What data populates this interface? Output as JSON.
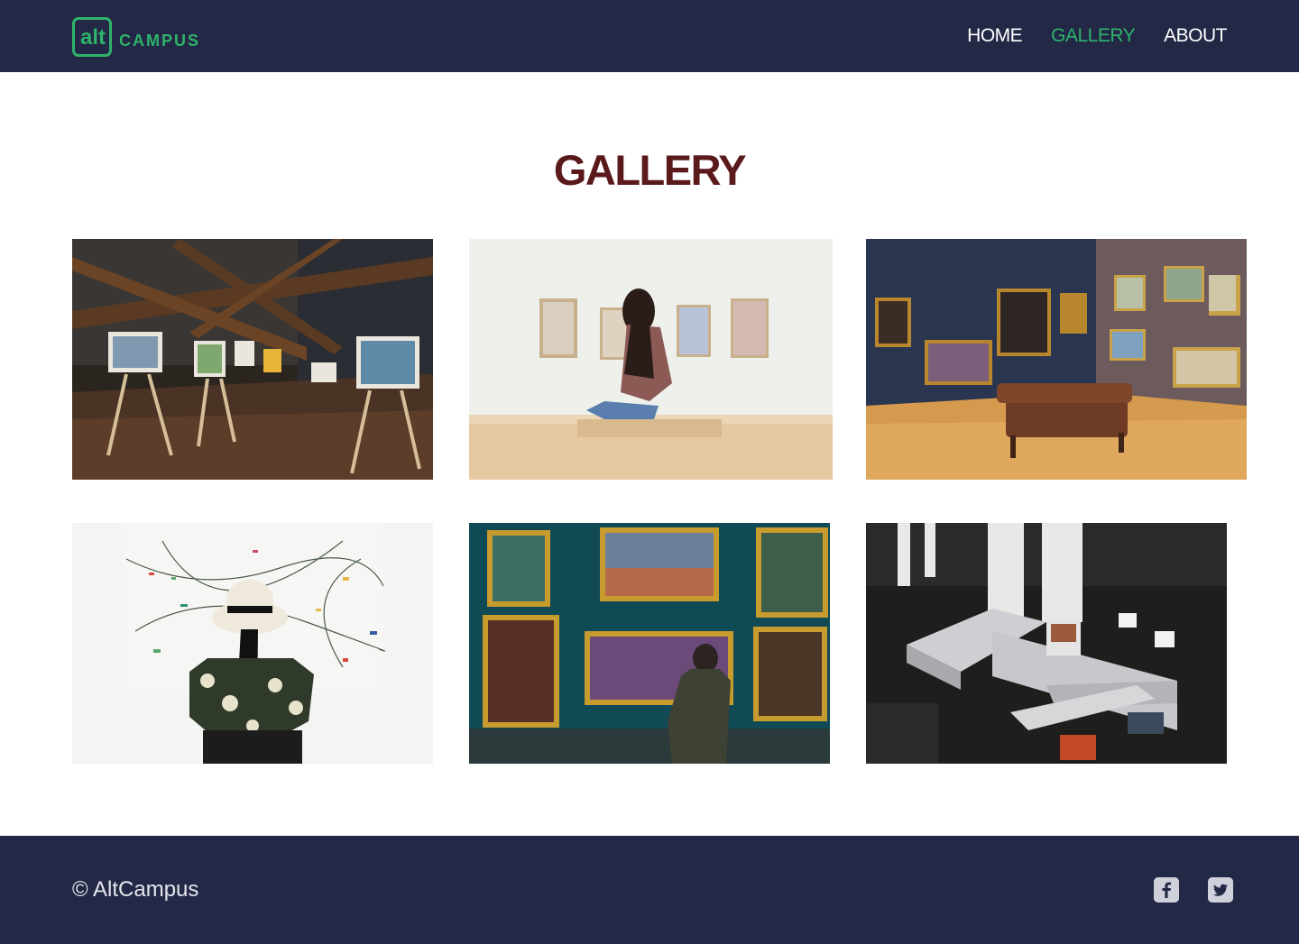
{
  "header": {
    "logo": {
      "alt_text": "alt",
      "campus_text": "CAMPUS"
    },
    "nav": [
      {
        "label": "HOME"
      },
      {
        "label": "GALLERY",
        "active": true
      },
      {
        "label": "ABOUT"
      }
    ]
  },
  "main": {
    "title": "GALLERY",
    "gallery": [
      {
        "subject": "easels-with-paintings"
      },
      {
        "subject": "woman-sitting-in-gallery"
      },
      {
        "subject": "museum-room-with-sofa"
      },
      {
        "subject": "woman-with-hat-viewing-abstract-art"
      },
      {
        "subject": "man-viewing-framed-paintings"
      },
      {
        "subject": "exhibition-hall-aerial"
      }
    ]
  },
  "footer": {
    "copyright": "© AltCampus",
    "social": [
      {
        "icon": "facebook-icon"
      },
      {
        "icon": "twitter-icon"
      }
    ]
  },
  "colors": {
    "header_bg": "#222845",
    "accent": "#2fb36b",
    "title": "#5a1a1c",
    "footer_bg": "#222845"
  }
}
